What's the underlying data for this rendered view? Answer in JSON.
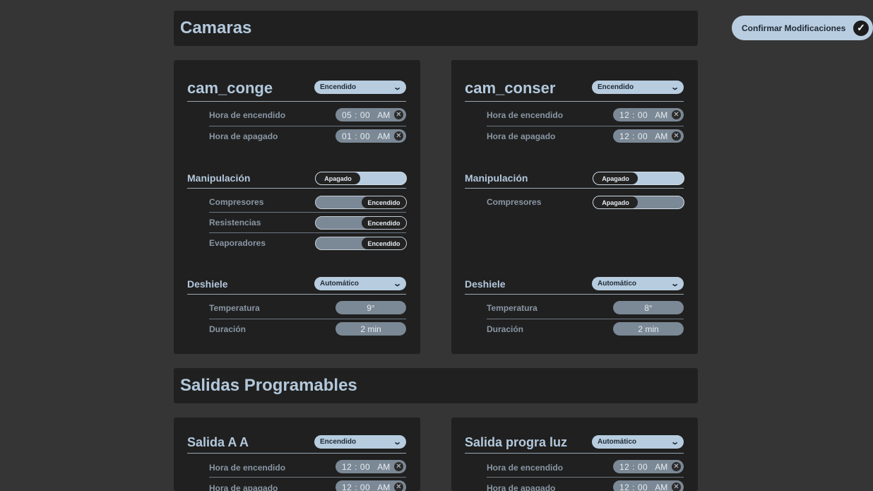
{
  "confirm_button": {
    "label": "Confirmar Modificaciones"
  },
  "sections": {
    "camaras": {
      "title": "Camaras"
    },
    "salidas": {
      "title": "Salidas Programables"
    }
  },
  "cam_conge": {
    "name": "cam_conge",
    "state": "Encendido",
    "hora_encendido": {
      "label": "Hora de encendido",
      "time": "05 : 00",
      "ampm": "AM"
    },
    "hora_apagado": {
      "label": "Hora de apagado",
      "time": "01 : 00",
      "ampm": "AM"
    },
    "manipulacion": {
      "label": "Manipulación",
      "state": "Apagado",
      "items": [
        {
          "label": "Compresores",
          "state": "Encendido"
        },
        {
          "label": "Resistencias",
          "state": "Encendido"
        },
        {
          "label": "Evaporadores",
          "state": "Encendido"
        }
      ]
    },
    "deshiele": {
      "label": "Deshiele",
      "mode": "Automático",
      "temperatura": {
        "label": "Temperatura",
        "value": "9°"
      },
      "duracion": {
        "label": "Duración",
        "value": "2 min"
      }
    }
  },
  "cam_conser": {
    "name": "cam_conser",
    "state": "Encendido",
    "hora_encendido": {
      "label": "Hora de encendido",
      "time": "12 : 00",
      "ampm": "AM"
    },
    "hora_apagado": {
      "label": "Hora de apagado",
      "time": "12 : 00",
      "ampm": "AM"
    },
    "manipulacion": {
      "label": "Manipulación",
      "state": "Apagado",
      "items": [
        {
          "label": "Compresores",
          "state": "Apagado"
        }
      ]
    },
    "deshiele": {
      "label": "Deshiele",
      "mode": "Automático",
      "temperatura": {
        "label": "Temperatura",
        "value": "8°"
      },
      "duracion": {
        "label": "Duración",
        "value": "2 min"
      }
    }
  },
  "salida_aa": {
    "name": "Salida A A",
    "state": "Encendido",
    "hora_encendido": {
      "label": "Hora de encendido",
      "time": "12 : 00",
      "ampm": "AM"
    },
    "hora_apagado": {
      "label": "Hora de apagado",
      "time": "12 : 00",
      "ampm": "AM"
    }
  },
  "salida_luz": {
    "name": "Salida progra luz",
    "state": "Automático",
    "hora_encendido": {
      "label": "Hora de encendido",
      "time": "12 : 00",
      "ampm": "AM"
    },
    "hora_apagado": {
      "label": "Hora de apagado",
      "time": "12 : 00",
      "ampm": "AM"
    }
  },
  "icons": {
    "check": "checkmark-icon",
    "clear": "clear-icon",
    "chevron": "chevron-down-icon"
  }
}
